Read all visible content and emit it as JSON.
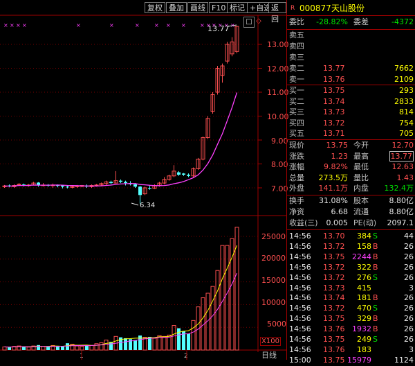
{
  "toolbar": {
    "buttons": [
      "复权",
      "叠加",
      "画线",
      "F10",
      "标记",
      "+自选",
      "返回"
    ],
    "small_icons": [
      "square-icon",
      "diamond-icon"
    ]
  },
  "stock": {
    "badge": "R",
    "code": "000877",
    "name": "天山股份"
  },
  "weibi": {
    "label": "委比",
    "value": "-28.82%",
    "label2": "委差",
    "value2": "-4372"
  },
  "sell_orders": [
    {
      "label": "卖五",
      "price": "",
      "volume": ""
    },
    {
      "label": "卖四",
      "price": "",
      "volume": ""
    },
    {
      "label": "卖三",
      "price": "",
      "volume": ""
    },
    {
      "label": "卖二",
      "price": "13.77",
      "volume": "7662"
    },
    {
      "label": "卖一",
      "price": "13.76",
      "volume": "2109"
    }
  ],
  "buy_orders": [
    {
      "label": "买一",
      "price": "13.75",
      "volume": "293"
    },
    {
      "label": "买二",
      "price": "13.74",
      "volume": "2833"
    },
    {
      "label": "买三",
      "price": "13.73",
      "volume": "814"
    },
    {
      "label": "买四",
      "price": "13.72",
      "volume": "754"
    },
    {
      "label": "买五",
      "price": "13.71",
      "volume": "705"
    }
  ],
  "quote": [
    {
      "l1": "现价",
      "v1": "13.75",
      "l2": "今开",
      "v2": "12.70"
    },
    {
      "l1": "涨跌",
      "v1": "1.23",
      "l2": "最高",
      "v2": "13.77"
    },
    {
      "l1": "涨幅",
      "v1": "9.82%",
      "l2": "最低",
      "v2": "12.63"
    },
    {
      "l1": "总量",
      "v1": "273.5万",
      "l2": "量比",
      "v2": "1.43"
    },
    {
      "l1": "外盘",
      "v1": "141.1万",
      "l2": "内盘",
      "v2": "132.4万"
    }
  ],
  "stats": [
    {
      "l1": "换手",
      "v1": "31.08%",
      "l2": "股本",
      "v2": "8.80亿"
    },
    {
      "l1": "净资",
      "v1": "6.68",
      "l2": "流通",
      "v2": "8.80亿"
    },
    {
      "l1": "收益(三)",
      "v1": "0.005",
      "l2": "PE(动)",
      "v2": "2097.1"
    }
  ],
  "ticks": [
    {
      "time": "14:56",
      "price": "13.70",
      "vol": "384",
      "side": "S",
      "num": "44"
    },
    {
      "time": "14:56",
      "price": "13.72",
      "vol": "158",
      "side": "B",
      "num": "26"
    },
    {
      "time": "14:56",
      "price": "13.75",
      "vol": "2244",
      "side": "B",
      "num": "26"
    },
    {
      "time": "14:56",
      "price": "13.72",
      "vol": "322",
      "side": "B",
      "num": "26"
    },
    {
      "time": "14:56",
      "price": "13.72",
      "vol": "276",
      "side": "S",
      "num": "26"
    },
    {
      "time": "14:56",
      "price": "13.73",
      "vol": "415",
      "side": "",
      "num": "3"
    },
    {
      "time": "14:56",
      "price": "13.74",
      "vol": "181",
      "side": "B",
      "num": "26"
    },
    {
      "time": "14:56",
      "price": "13.72",
      "vol": "470",
      "side": "S",
      "num": "26"
    },
    {
      "time": "14:56",
      "price": "13.75",
      "vol": "329",
      "side": "B",
      "num": "26"
    },
    {
      "time": "14:56",
      "price": "13.76",
      "vol": "1932",
      "side": "B",
      "num": "26"
    },
    {
      "time": "14:56",
      "price": "13.75",
      "vol": "249",
      "side": "S",
      "num": "26"
    },
    {
      "time": "14:56",
      "price": "13.76",
      "vol": "183",
      "side": "",
      "num": "3"
    },
    {
      "time": "15:00",
      "price": "13.75",
      "vol": "15979",
      "side": "",
      "num": "1124"
    }
  ],
  "chart": {
    "price_axis": [
      "13.00",
      "12.00",
      "11.00",
      "10.00",
      "9.00",
      "8.00",
      "7.00"
    ],
    "volume_axis": [
      "25000",
      "20000",
      "15000",
      "10000",
      "5000"
    ],
    "volume_unit": "X100",
    "high_label": "13.77",
    "low_label": "6.34",
    "period_tab": "日线",
    "bottom_markers": [
      "1",
      "2"
    ]
  },
  "colors": {
    "up": "#ff5050",
    "down": "#54ffff",
    "ma1": "#ffff00",
    "ma2": "#ff40ff",
    "border": "#a00000"
  }
}
